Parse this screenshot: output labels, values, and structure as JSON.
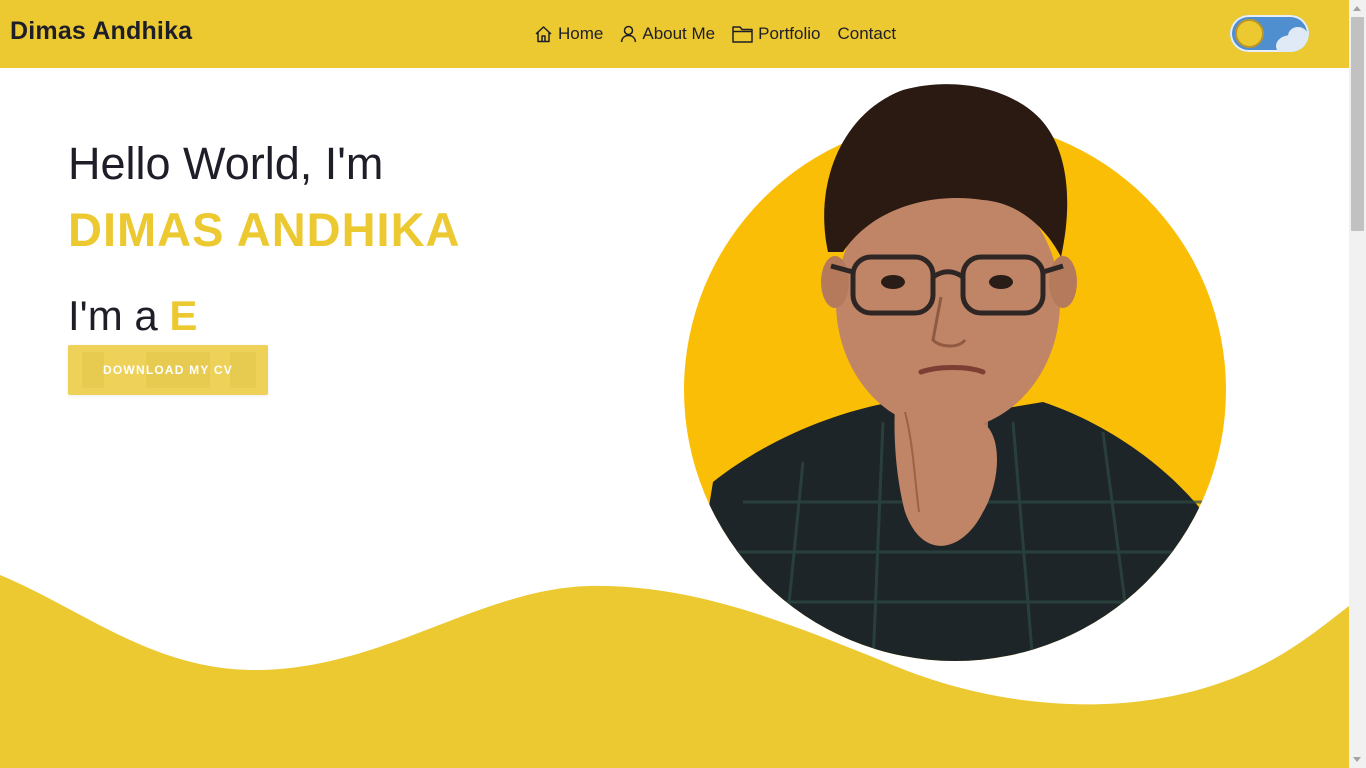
{
  "header": {
    "brand": "Dimas Andhika",
    "nav": [
      {
        "label": "Home",
        "icon": "home-icon"
      },
      {
        "label": "About Me",
        "icon": "user-icon"
      },
      {
        "label": "Portfolio",
        "icon": "folder-icon"
      },
      {
        "label": "Contact",
        "icon": ""
      }
    ],
    "theme_toggle": {
      "state": "light",
      "icon": "sun-cloud-toggle"
    }
  },
  "hero": {
    "greeting": "Hello World, I'm",
    "name": "DIMAS ANDHIKA",
    "role_prefix": "I'm a",
    "role_typed": "E",
    "cv_button": "DOWNLOAD MY CV",
    "photo_icon": "profile-photo"
  },
  "colors": {
    "accent": "#ecc931",
    "photo_circle": "#fbbe07",
    "text": "#1e1e28",
    "background": "#ffffff"
  }
}
